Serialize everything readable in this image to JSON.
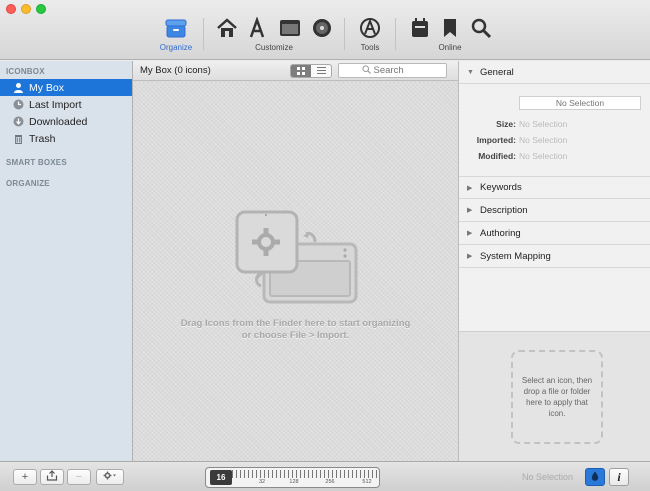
{
  "toolbar": {
    "groups": [
      {
        "label": "Organize",
        "active": true
      },
      {
        "label": "Customize"
      },
      {
        "label": "Tools"
      },
      {
        "label": "Online"
      }
    ],
    "icons": [
      "organize-box-icon",
      "home-icon",
      "app-store-icon",
      "window-icon",
      "cd-icon",
      "tools-icon",
      "calendar-icon",
      "bookmark-icon",
      "search-icon"
    ]
  },
  "sidebar": {
    "headers": [
      "ICONBOX",
      "SMART BOXES",
      "ORGANIZE"
    ],
    "items": [
      {
        "label": "My Box",
        "icon": "user-icon",
        "selected": true
      },
      {
        "label": "Last Import",
        "icon": "clock-icon"
      },
      {
        "label": "Downloaded",
        "icon": "download-icon"
      },
      {
        "label": "Trash",
        "icon": "trash-icon"
      }
    ]
  },
  "center": {
    "title": "My Box (0 icons)",
    "search_placeholder": "Search",
    "drop_line1": "Drag Icons from the Finder here to start organizing",
    "drop_line2": "or choose File > Import."
  },
  "inspector": {
    "general_label": "General",
    "name_placeholder": "No Selection",
    "fields": [
      {
        "label": "Size:",
        "value": "No Selection"
      },
      {
        "label": "Imported:",
        "value": "No Selection"
      },
      {
        "label": "Modified:",
        "value": "No Selection"
      }
    ],
    "sections": [
      "Keywords",
      "Description",
      "Authoring",
      "System Mapping"
    ],
    "apply_hint": "Select an icon, then drop a file or folder here to apply that icon."
  },
  "bottom": {
    "add_label": "+",
    "remove_label": "−",
    "size_value": "16",
    "size_ticks": [
      "32",
      "128",
      "256",
      "512"
    ],
    "status": "No Selection",
    "info_label": "i",
    "colors": {
      "accent": "#1d74d9",
      "selected_row": "#1d74d9"
    }
  }
}
